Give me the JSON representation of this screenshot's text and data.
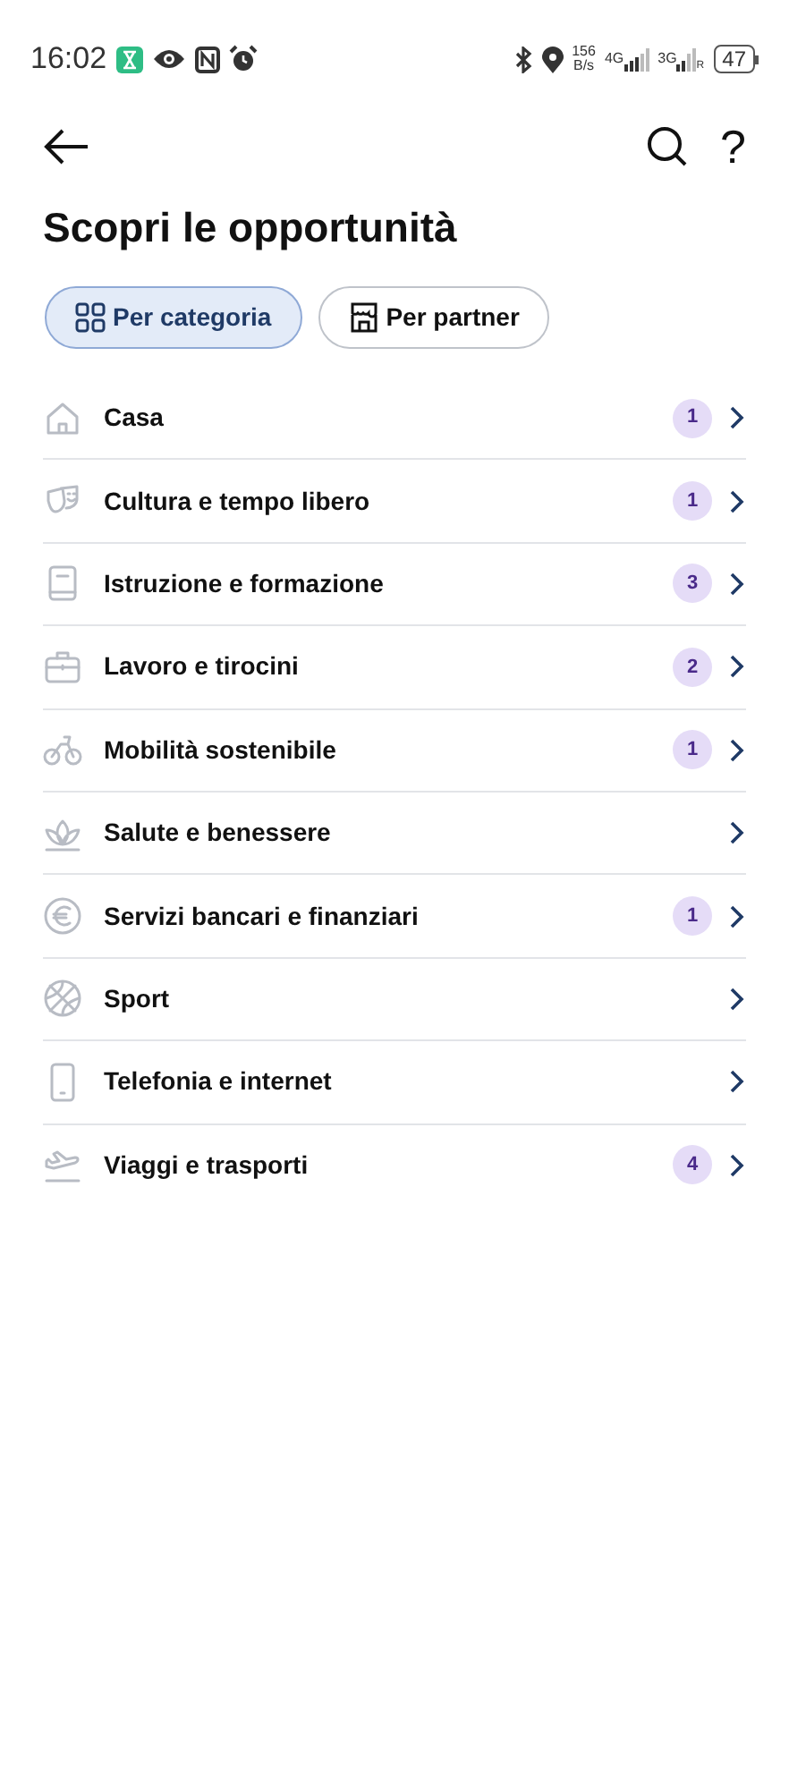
{
  "status_bar": {
    "time": "16:02",
    "speed": "156",
    "speed_unit": "B/s",
    "network_1": "4G",
    "network_2": "3G",
    "roaming": "R",
    "battery": "47"
  },
  "header": {
    "help": "?"
  },
  "title": "Scopri le opportunità",
  "tabs": [
    {
      "label": "Per categoria",
      "selected": true
    },
    {
      "label": "Per partner",
      "selected": false
    }
  ],
  "categories": [
    {
      "label": "Casa",
      "count": "1"
    },
    {
      "label": "Cultura e tempo libero",
      "count": "1"
    },
    {
      "label": "Istruzione e formazione",
      "count": "3"
    },
    {
      "label": "Lavoro e tirocini",
      "count": "2"
    },
    {
      "label": "Mobilità sostenibile",
      "count": "1"
    },
    {
      "label": "Salute e benessere"
    },
    {
      "label": "Servizi bancari e finanziari",
      "count": "1"
    },
    {
      "label": "Sport"
    },
    {
      "label": "Telefonia e internet"
    },
    {
      "label": "Viaggi e trasporti",
      "count": "4"
    }
  ]
}
